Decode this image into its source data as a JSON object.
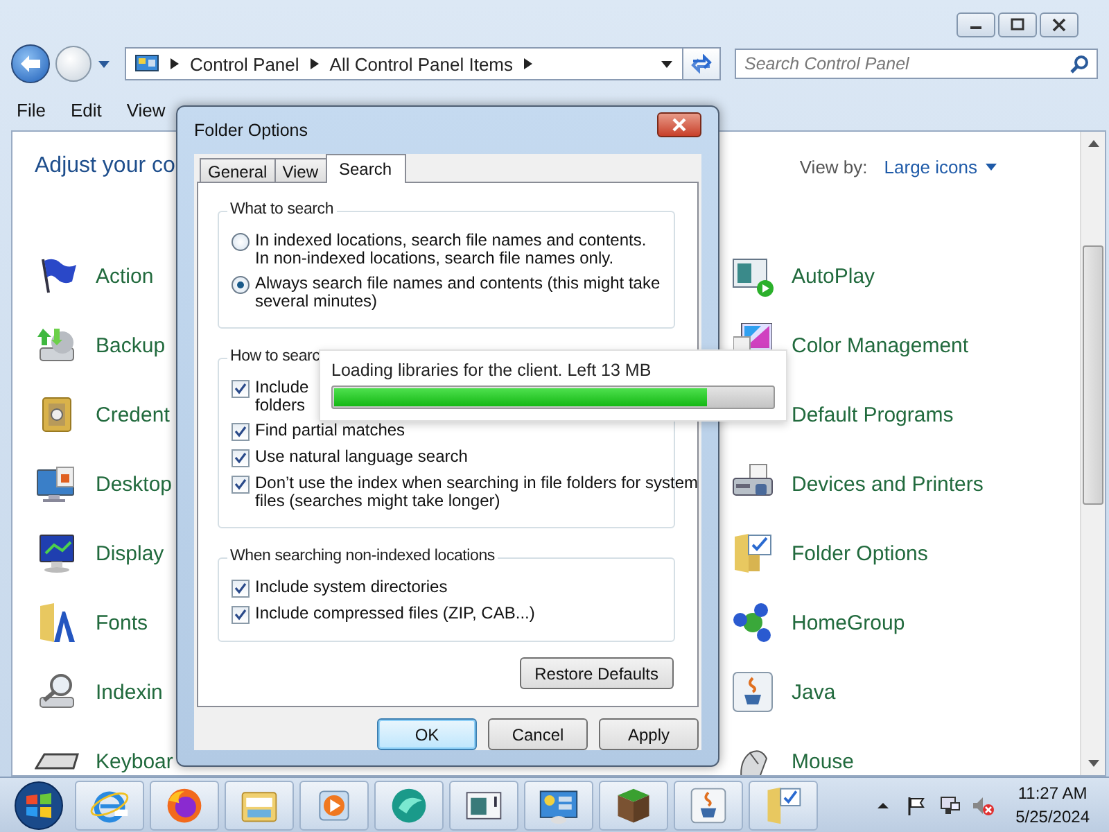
{
  "window": {
    "address": [
      "Control Panel",
      "All Control Panel Items"
    ],
    "search": {
      "placeholder": "Search Control Panel"
    },
    "menu": [
      "File",
      "Edit",
      "View"
    ]
  },
  "content": {
    "heading": "Adjust your co",
    "view_by_label": "View by:",
    "view_by_value": "Large icons",
    "items_left": [
      {
        "label": "Action",
        "kind": "flag"
      },
      {
        "label": "Backup",
        "kind": "backup"
      },
      {
        "label": "Credent",
        "kind": "safe"
      },
      {
        "label": "Desktop",
        "kind": "desktop"
      },
      {
        "label": "Display",
        "kind": "display"
      },
      {
        "label": "Fonts",
        "kind": "fonts"
      },
      {
        "label": "Indexin",
        "kind": "indexing"
      },
      {
        "label": "Keyboar",
        "kind": "keyboard"
      }
    ],
    "items_right": [
      {
        "label": "AutoPlay",
        "kind": "autoplay"
      },
      {
        "label": "Color Management",
        "kind": "color"
      },
      {
        "label": "Default Programs"
      },
      {
        "label": "Devices and Printers",
        "kind": "printer"
      },
      {
        "label": "Folder Options",
        "kind": "folder"
      },
      {
        "label": "HomeGroup",
        "kind": "homegroup"
      },
      {
        "label": "Java",
        "kind": "java"
      },
      {
        "label": "Mouse",
        "kind": "mouse"
      }
    ]
  },
  "dialog": {
    "title": "Folder Options",
    "tabs": [
      {
        "label": "General",
        "selected": false
      },
      {
        "label": "View",
        "selected": false
      },
      {
        "label": "Search",
        "selected": true
      }
    ],
    "groups": [
      {
        "title": "What to search",
        "options": [
          {
            "kind": "radio",
            "lines": [
              "In indexed locations, search file names and contents.",
              "In non-indexed locations, search file names only."
            ],
            "selected": false
          },
          {
            "kind": "radio",
            "lines": [
              "Always search file names and contents (this might take",
              "several minutes)"
            ],
            "selected": true
          }
        ]
      },
      {
        "title": "How to searc",
        "options": [
          {
            "kind": "checkbox",
            "lines": [
              "Include",
              "folders"
            ],
            "checked": true
          },
          {
            "kind": "checkbox",
            "lines": [
              "Find partial matches"
            ],
            "checked": true
          },
          {
            "kind": "checkbox",
            "lines": [
              "Use natural language search"
            ],
            "checked": true
          },
          {
            "kind": "checkbox",
            "lines": [
              "Don’t use the index when searching in file folders for system",
              "files (searches might take longer)"
            ],
            "checked": true
          }
        ]
      },
      {
        "title": "When searching non-indexed locations",
        "options": [
          {
            "kind": "checkbox",
            "lines": [
              "Include system directories"
            ],
            "checked": true
          },
          {
            "kind": "checkbox",
            "lines": [
              "Include compressed files (ZIP, CAB...)"
            ],
            "checked": true
          }
        ]
      }
    ],
    "restore_button": "Restore Defaults",
    "buttons": [
      {
        "label": "OK",
        "default": true
      },
      {
        "label": "Cancel",
        "default": false
      },
      {
        "label": "Apply",
        "default": false
      }
    ]
  },
  "loading": {
    "message": "Loading libraries for the client. Left 13 MB",
    "level": 0.85
  },
  "taskbar": {
    "apps": [
      {
        "kind": "ie"
      },
      {
        "kind": "firefox"
      },
      {
        "kind": "explorer"
      },
      {
        "kind": "media"
      },
      {
        "kind": "teal"
      },
      {
        "kind": "window"
      },
      {
        "kind": "controlpanel"
      },
      {
        "kind": "block"
      },
      {
        "kind": "java"
      },
      {
        "kind": "folder"
      }
    ],
    "time": "11:27 AM",
    "date": "5/25/2024"
  }
}
